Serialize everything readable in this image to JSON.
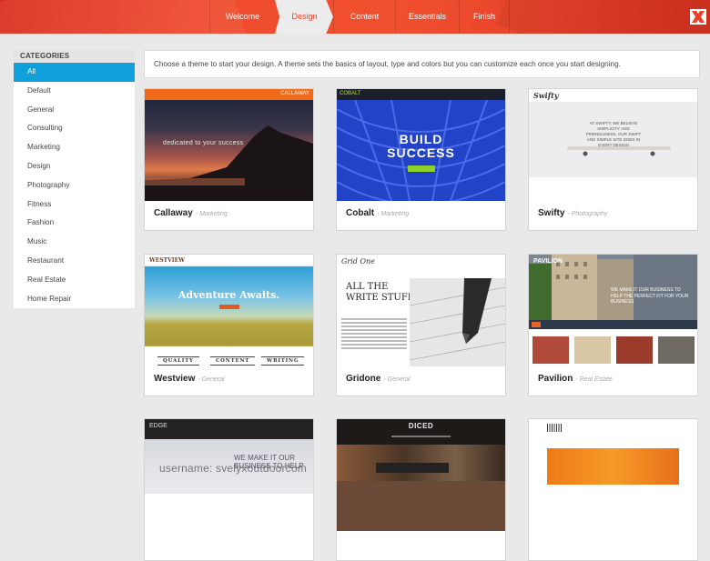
{
  "wizard": {
    "steps": [
      {
        "label": "Welcome",
        "active": false
      },
      {
        "label": "Design",
        "active": true
      },
      {
        "label": "Content",
        "active": false
      },
      {
        "label": "Essentials",
        "active": false
      },
      {
        "label": "Finish",
        "active": false
      }
    ],
    "close_icon": "close-x-icon",
    "accent_color": "#ef4a2c"
  },
  "sidebar": {
    "title": "CATEGORIES",
    "selected_color": "#0fa0dc",
    "items": [
      {
        "label": "All",
        "selected": true
      },
      {
        "label": "Default"
      },
      {
        "label": "General"
      },
      {
        "label": "Consulting"
      },
      {
        "label": "Marketing"
      },
      {
        "label": "Design"
      },
      {
        "label": "Photography"
      },
      {
        "label": "Fitness"
      },
      {
        "label": "Fashion"
      },
      {
        "label": "Music"
      },
      {
        "label": "Restaurant"
      },
      {
        "label": "Real Estate"
      },
      {
        "label": "Home Repair"
      }
    ]
  },
  "intro_text": "Choose a theme to start your design. A theme sets the basics of layout, type and colors but you can customize each once you start designing.",
  "themes": [
    {
      "name": "Callaway",
      "category": "- Marketing",
      "preview": {
        "logo": "CALLAWAY",
        "tagline": "dedicated to your success"
      }
    },
    {
      "name": "Cobalt",
      "category": "- Marketing",
      "preview": {
        "logo": "COBALT",
        "headline_1": "BUILD",
        "headline_2": "SUCCESS"
      }
    },
    {
      "name": "Swifty",
      "category": "- Photography",
      "preview": {
        "logo": "Swifty",
        "text": "AT SWIFTY, WE BELIEVE SIMPLICITY AND FRIENDLINESS, OUR SWIFT AND SIMPLE SITE DOES IN EVERY DESIGN"
      }
    },
    {
      "name": "Westview",
      "category": "- General",
      "preview": {
        "logo": "WESTVIEW",
        "headline": "Adventure Awaits.",
        "footer": [
          "QUALITY",
          "CONTENT",
          "WRITING"
        ]
      }
    },
    {
      "name": "Gridone",
      "category": "- General",
      "preview": {
        "logo": "Grid One",
        "headline": "ALL THE WRITE STUFF"
      }
    },
    {
      "name": "Pavilion",
      "category": "- Real Estate",
      "preview": {
        "logo": "PAVILION",
        "text": "WE MAKE IT OUR BUSINESS TO HELP THE PERFECT FIT FOR YOUR BUSINESS"
      }
    },
    {
      "name": "",
      "category": "",
      "preview": {
        "logo": "EDGE",
        "text_1": "WE MAKE IT OUR",
        "text_2": "BUSINESS TO HELP"
      }
    },
    {
      "name": "",
      "category": "",
      "preview": {
        "logo": "DICED"
      }
    },
    {
      "name": "",
      "category": "",
      "preview": {
        "logo": ""
      }
    }
  ],
  "overlay_text": "username: svelyxoutdoorcom"
}
